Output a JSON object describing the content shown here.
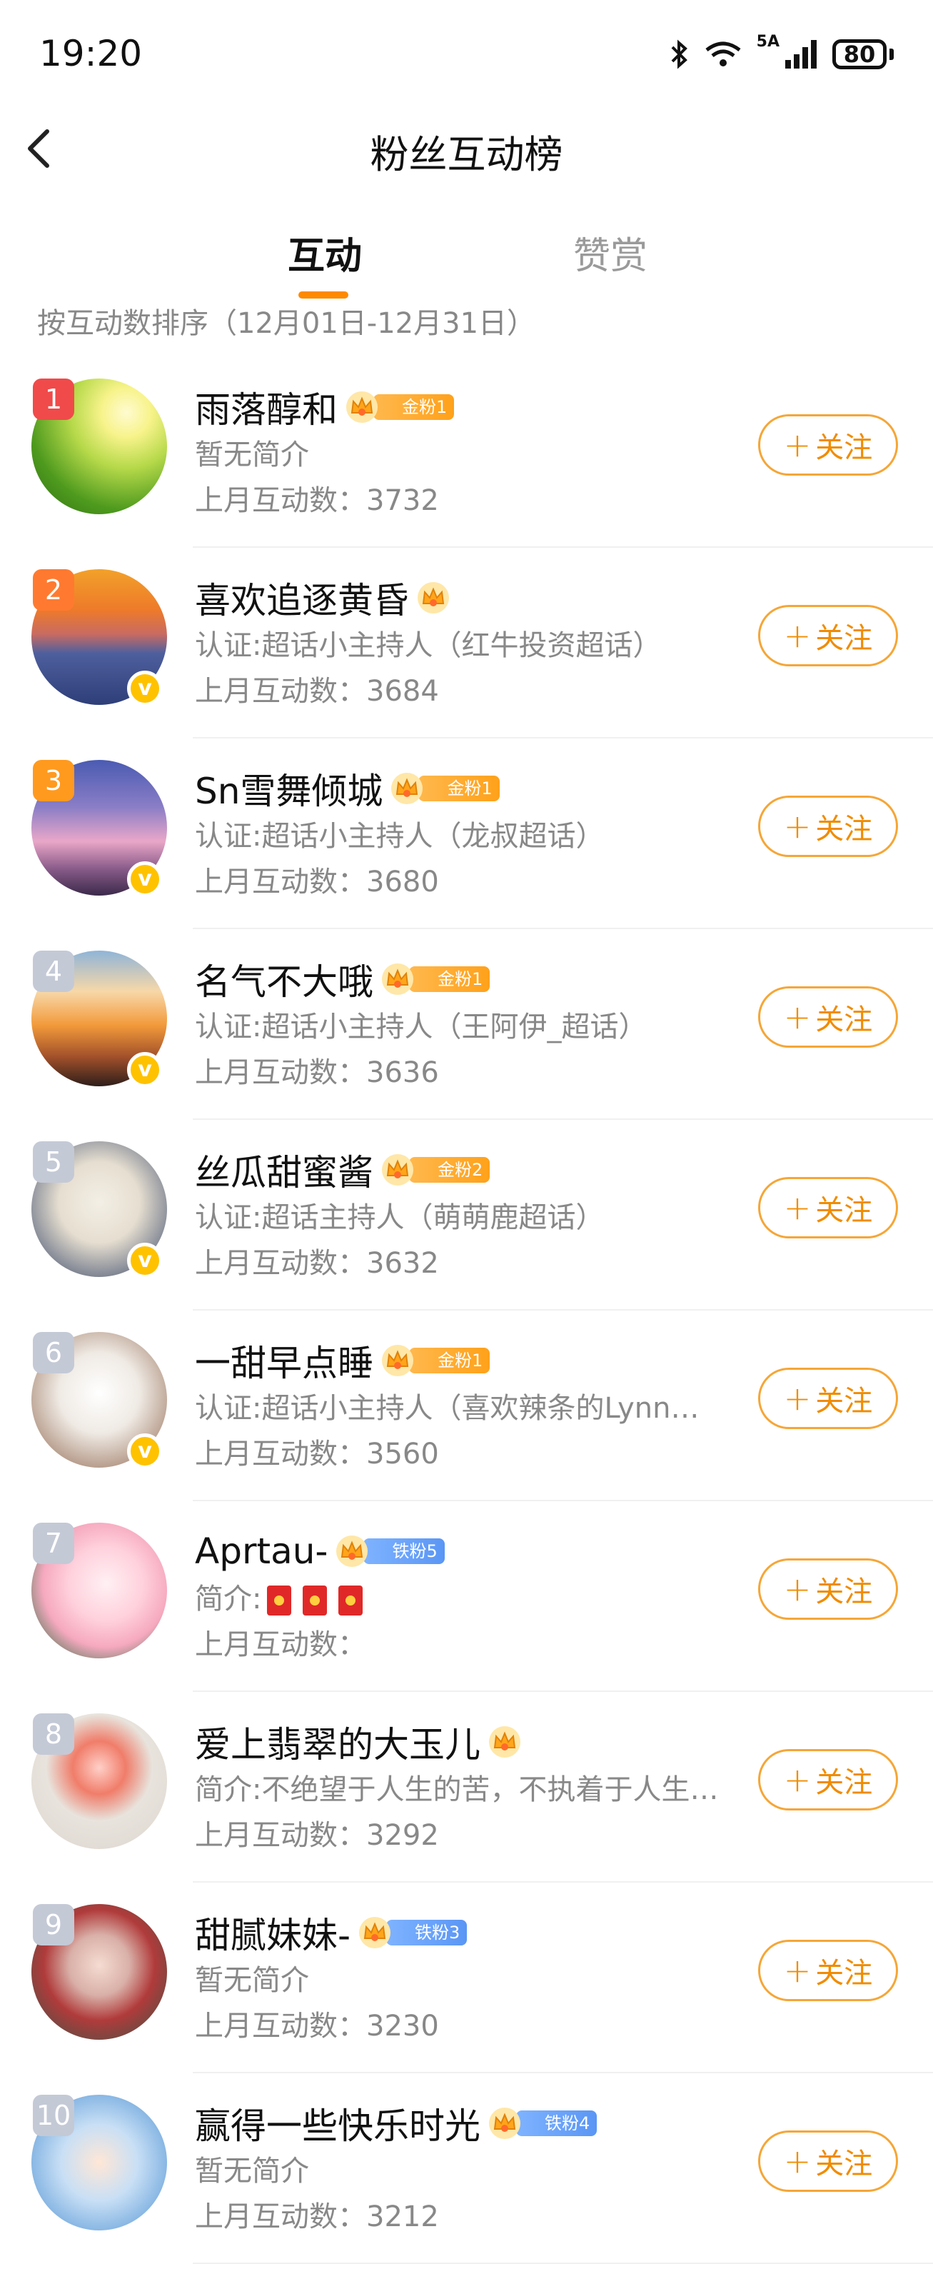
{
  "status": {
    "time": "19:20",
    "battery": "80",
    "network": "5A"
  },
  "nav": {
    "title": "粉丝互动榜"
  },
  "tabs": {
    "active": "互动",
    "inactive": "赞赏"
  },
  "sort_note": "按互动数排序（12月01日-12月31日）",
  "follow_label": "关注",
  "count_prefix": "上月互动数：",
  "colors": {
    "accent": "#ff8a00",
    "rank_top1": "#f04a4a",
    "rank_top2": "#ff7a30",
    "rank_top3": "#ff9a1f",
    "rank_other": "#c4c9d6",
    "verified": "#ffc200"
  },
  "fans": [
    {
      "rank": "1",
      "name": "雨落醇和",
      "badge": "金粉1",
      "badge_type": "gold",
      "intro": "暂无简介",
      "count": "3732",
      "verified": false,
      "avatar_icon": "tea-leaf-sunlight"
    },
    {
      "rank": "2",
      "name": "喜欢追逐黄昏",
      "badge": "",
      "badge_type": "crown-only",
      "intro": "认证:超话小主持人（红牛投资超话）",
      "count": "3684",
      "verified": true,
      "avatar_icon": "sunset-mountain"
    },
    {
      "rank": "3",
      "name": "Sn雪舞倾城",
      "badge": "金粉1",
      "badge_type": "gold",
      "intro": "认证:超话小主持人（龙叔超话）",
      "count": "3680",
      "verified": true,
      "avatar_icon": "dusk-figure"
    },
    {
      "rank": "4",
      "name": "名气不大哦",
      "badge": "金粉1",
      "badge_type": "gold",
      "intro": "认证:超话小主持人（王阿伊_超话）",
      "count": "3636",
      "verified": true,
      "avatar_icon": "sunset-hand"
    },
    {
      "rank": "5",
      "name": "丝瓜甜蜜酱",
      "badge": "金粉2",
      "badge_type": "gold",
      "intro": "认证:超话主持人（萌萌鹿超话）",
      "count": "3632",
      "verified": true,
      "avatar_icon": "white-dog"
    },
    {
      "rank": "6",
      "name": "一甜早点睡",
      "badge": "金粉1",
      "badge_type": "gold",
      "intro": "认证:超话小主持人（喜欢辣条的Lynn超…",
      "count": "3560",
      "verified": true,
      "avatar_icon": "duck-plush"
    },
    {
      "rank": "7",
      "name": "Aprtau-",
      "badge": "铁粉5",
      "badge_type": "iron",
      "intro": "简介:",
      "count": "",
      "verified": false,
      "avatar_icon": "anime-girl",
      "intro_red_packets": 3
    },
    {
      "rank": "8",
      "name": "爱上翡翠的大玉儿",
      "badge": "",
      "badge_type": "crown-only",
      "intro": "简介:不绝望于人生的苦，不执着于人生…",
      "count": "3292",
      "verified": false,
      "avatar_icon": "monkey-figurine"
    },
    {
      "rank": "9",
      "name": "甜腻妹妹-",
      "badge": "铁粉3",
      "badge_type": "iron",
      "intro": "暂无简介",
      "count": "3230",
      "verified": false,
      "avatar_icon": "girl-photo"
    },
    {
      "rank": "10",
      "name": "赢得一些快乐时光",
      "badge": "铁粉4",
      "badge_type": "iron",
      "intro": "暂无简介",
      "count": "3212",
      "verified": false,
      "avatar_icon": "anime-boy"
    }
  ]
}
